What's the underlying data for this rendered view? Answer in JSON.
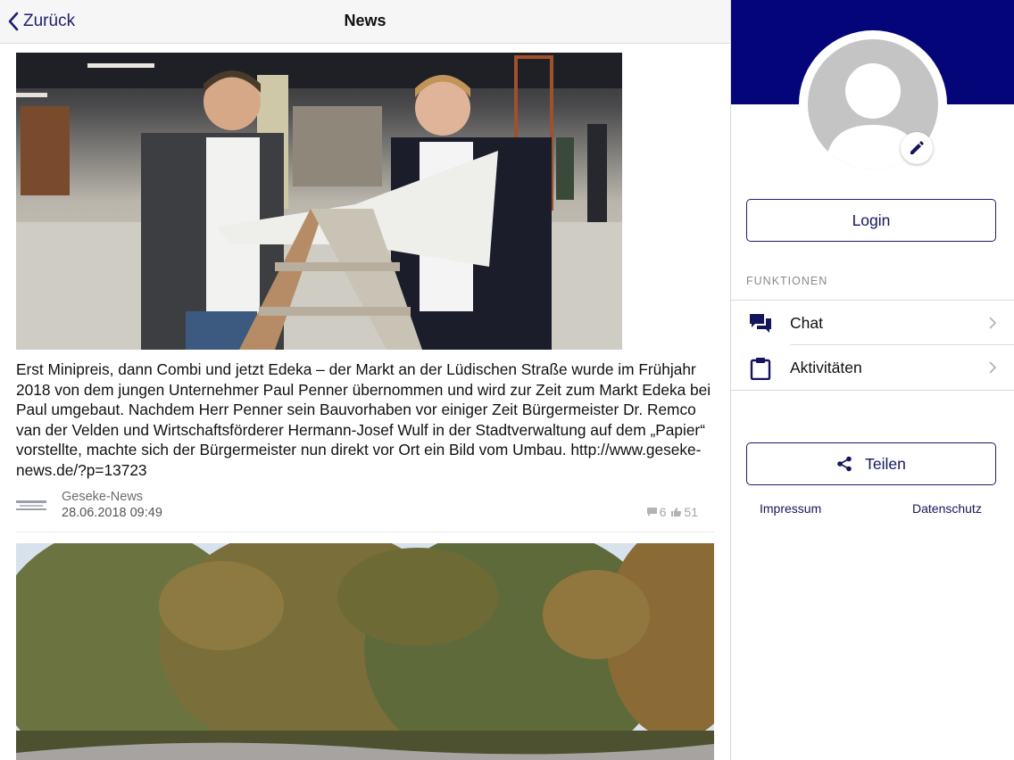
{
  "navbar": {
    "back_label": "Zurück",
    "title": "News"
  },
  "feed": {
    "posts": [
      {
        "text": "Erst Minipreis, dann Combi und jetzt Edeka – der Markt an der Lüdischen Straße wurde im Frühjahr 2018 von dem jungen Unternehmer Paul Penner übernommen und wird zur Zeit zum Markt Edeka bei Paul umgebaut. Nachdem Herr Penner sein Bauvorhaben vor einiger Zeit Bürgermeister Dr. Remco van der Velden und Wirtschaftsförderer Hermann-Josef Wulf in der Stadtverwaltung auf dem „Papier“ vorstellte, machte sich der Bürgermeister nun direkt vor Ort ein Bild vom Umbau. http://www.geseke-news.de/?p=13723",
        "source": "Geseke-News",
        "date": "28.06.2018 09:49",
        "comments": "6",
        "likes": "51"
      }
    ]
  },
  "sidebar": {
    "login_label": "Login",
    "section_label": "FUNKTIONEN",
    "menu": [
      {
        "label": "Chat",
        "icon": "chat-icon"
      },
      {
        "label": "Aktivitäten",
        "icon": "clipboard-icon"
      }
    ],
    "share_label": "Teilen",
    "footer": {
      "impressum": "Impressum",
      "datenschutz": "Datenschutz"
    }
  },
  "colors": {
    "brand": "#05057a",
    "accent_text": "#15155e",
    "muted": "#8a8a8a"
  }
}
